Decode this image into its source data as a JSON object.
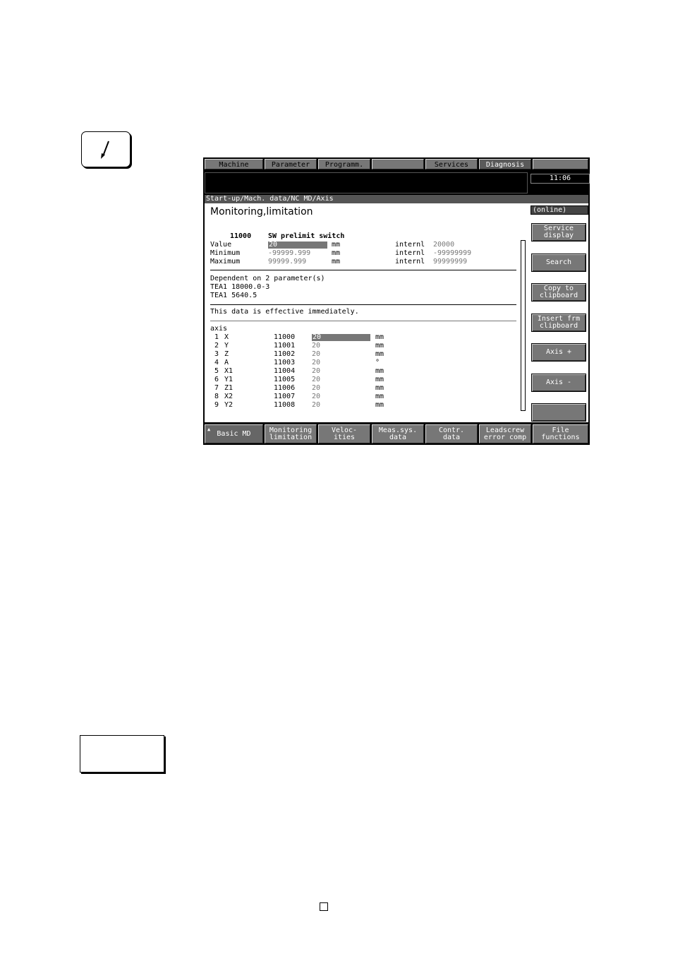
{
  "menu_tabs": [
    "Machine",
    "Parameter",
    "Programm.",
    "",
    "Services",
    "Diagnosis",
    ""
  ],
  "clock": "11:06",
  "breadcrumb": "Start-up/Mach. data/NC MD/Axis",
  "screen_title": "Monitoring,limitation",
  "mode_badge": "(online)",
  "param": {
    "number": "11000",
    "name": "SW prelimit switch",
    "rows": [
      {
        "label": "Value",
        "value": "20",
        "unit": "mm",
        "intern_label": "internl",
        "intern_value": "20000"
      },
      {
        "label": "Minimum",
        "value": "-99999.999",
        "unit": "mm",
        "intern_label": "internl",
        "intern_value": "-99999999"
      },
      {
        "label": "Maximum",
        "value": "99999.999",
        "unit": "mm",
        "intern_label": "internl",
        "intern_value": "99999999"
      }
    ]
  },
  "dependency": {
    "heading": "Dependent on 2 parameter(s)",
    "items": [
      "TEA1 18000.0-3",
      "TEA1 5640.5"
    ]
  },
  "effective_note": "This data is effective immediately.",
  "axis_table": {
    "header": "axis",
    "rows": [
      {
        "idx": "1",
        "name": "X",
        "md": "11000",
        "value": "20",
        "unit": "mm"
      },
      {
        "idx": "2",
        "name": "Y",
        "md": "11001",
        "value": "20",
        "unit": "mm"
      },
      {
        "idx": "3",
        "name": "Z",
        "md": "11002",
        "value": "20",
        "unit": "mm"
      },
      {
        "idx": "4",
        "name": "A",
        "md": "11003",
        "value": "20",
        "unit": "°"
      },
      {
        "idx": "5",
        "name": "X1",
        "md": "11004",
        "value": "20",
        "unit": "mm"
      },
      {
        "idx": "6",
        "name": "Y1",
        "md": "11005",
        "value": "20",
        "unit": "mm"
      },
      {
        "idx": "7",
        "name": "Z1",
        "md": "11006",
        "value": "20",
        "unit": "mm"
      },
      {
        "idx": "8",
        "name": "X2",
        "md": "11007",
        "value": "20",
        "unit": "mm"
      },
      {
        "idx": "9",
        "name": "Y2",
        "md": "11008",
        "value": "20",
        "unit": "mm"
      }
    ]
  },
  "vertical_softkeys": [
    "Service\ndisplay",
    "Search",
    "Copy to\nclipboard",
    "Insert frm\nclipboard",
    "Axis +",
    "Axis -",
    ""
  ],
  "horizontal_softkeys": [
    "Basic MD",
    "Monitoring\nlimitation",
    "Veloc-\nities",
    "Meas.sys.\ndata",
    "Contr.\ndata",
    "Leadscrew\nerror comp",
    "File\nfunctions"
  ]
}
